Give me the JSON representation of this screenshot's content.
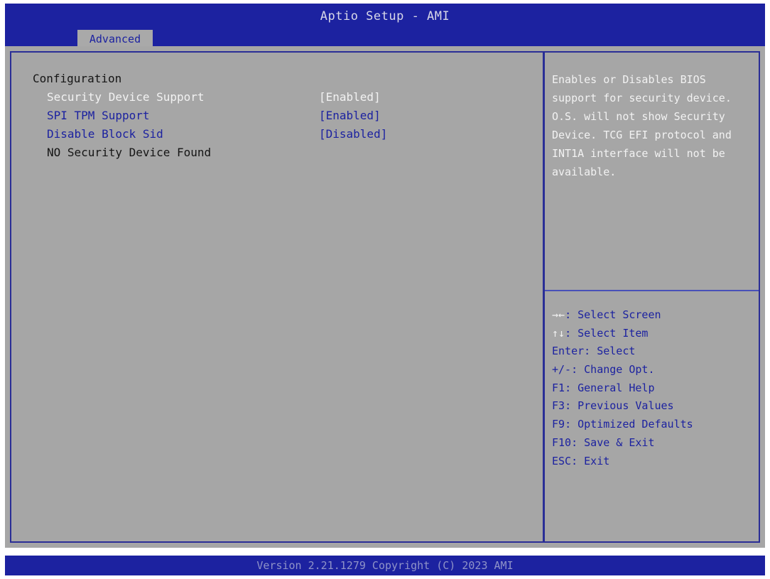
{
  "header": {
    "title": "Aptio Setup - AMI",
    "tab_label": "Advanced"
  },
  "main": {
    "section_title": "Configuration",
    "items": [
      {
        "label": "Security Device Support",
        "value": "[Enabled]"
      },
      {
        "label": "SPI TPM Support",
        "value": "[Enabled]"
      },
      {
        "label": "Disable Block Sid",
        "value": "[Disabled]"
      },
      {
        "label": "NO Security Device Found",
        "value": ""
      }
    ]
  },
  "help": {
    "description": "Enables or Disables BIOS support for security device. O.S. will not show Security Device. TCG EFI protocol and INT1A interface will not be available.",
    "keys": [
      {
        "key": "→←",
        "text": ": Select Screen"
      },
      {
        "key": "↑↓",
        "text": ": Select Item"
      },
      {
        "key": "Enter",
        "text": ": Select"
      },
      {
        "key": "+/-",
        "text": ": Change Opt."
      },
      {
        "key": "F1",
        "text": ": General Help"
      },
      {
        "key": "F3",
        "text": ": Previous Values"
      },
      {
        "key": "F9",
        "text": ": Optimized Defaults"
      },
      {
        "key": "F10",
        "text": ": Save & Exit"
      },
      {
        "key": "ESC",
        "text": ": Exit"
      }
    ]
  },
  "footer": {
    "version_text": "Version 2.21.1279 Copyright (C) 2023 AMI"
  },
  "colors": {
    "bios_blue": "#1c22a0",
    "panel_grey": "#a6a6a6",
    "highlight_white": "#f2f2f2"
  }
}
